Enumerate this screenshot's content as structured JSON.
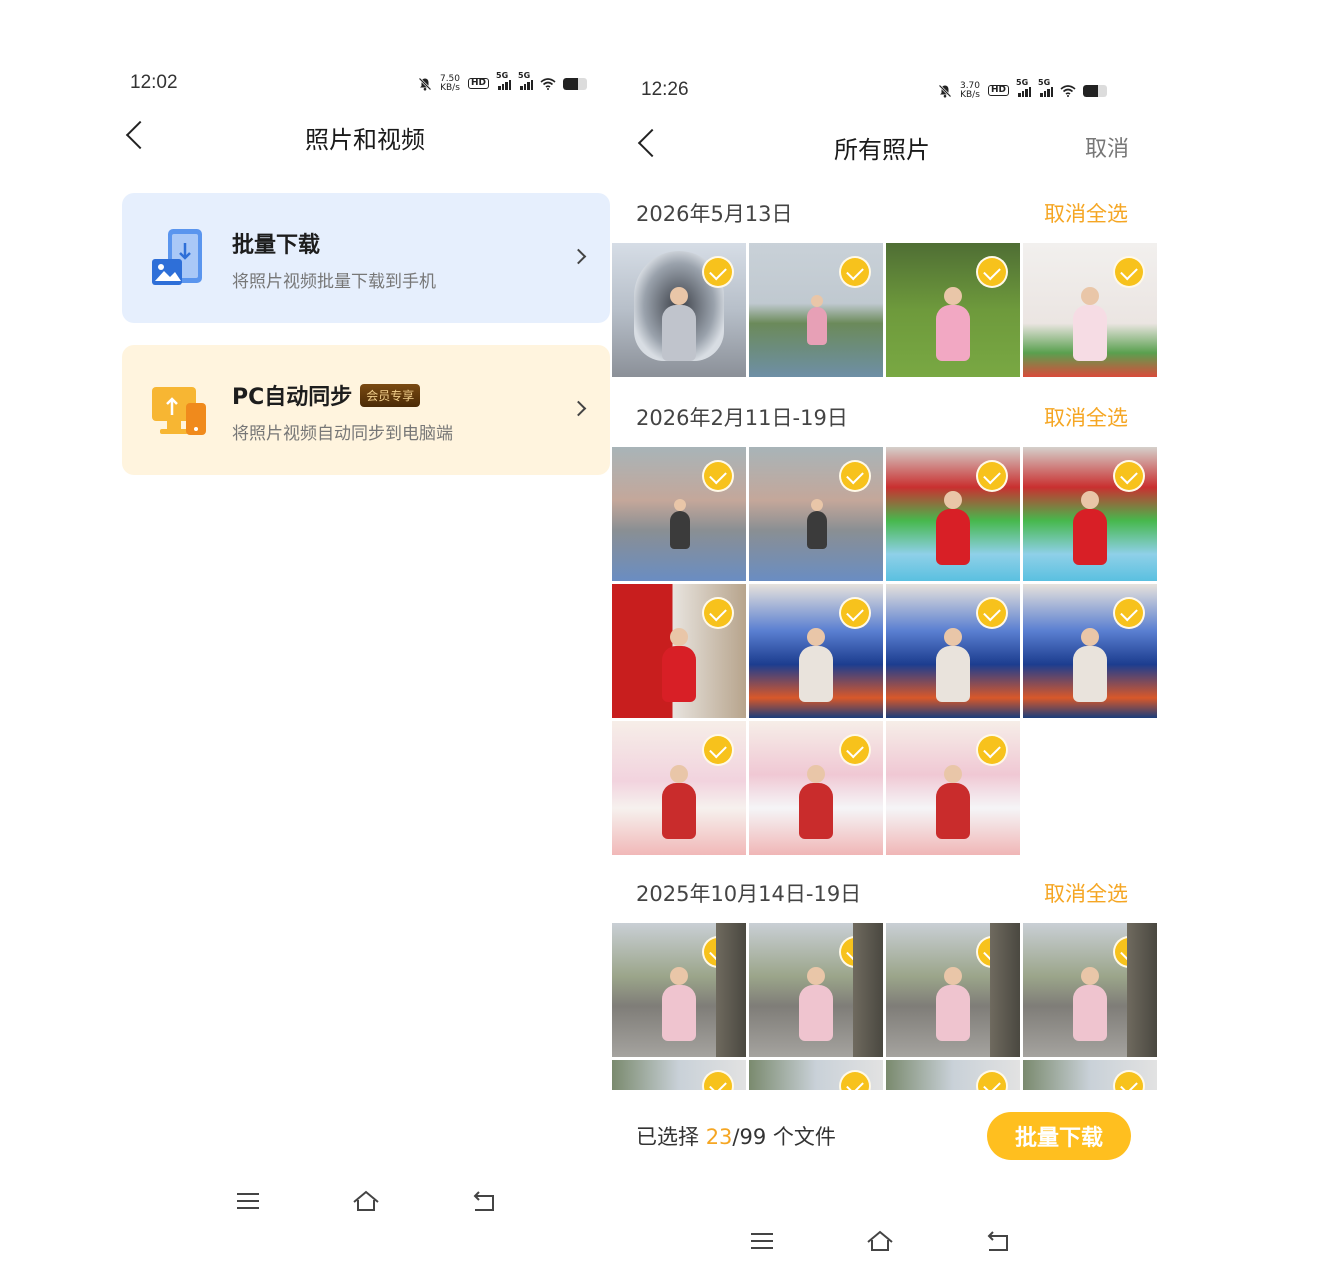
{
  "left_screen": {
    "status_bar": {
      "time": "12:02",
      "net_speed": "7.50",
      "net_unit": "KB/s"
    },
    "header": {
      "title": "照片和视频"
    },
    "cards": [
      {
        "title": "批量下载",
        "subtitle": "将照片视频批量下载到手机",
        "color": "#e6effd",
        "icon": "phone-download-icon"
      },
      {
        "title": "PC自动同步",
        "badge": "会员专享",
        "subtitle": "将照片视频自动同步到电脑端",
        "color": "#fff4de",
        "icon": "pc-sync-icon"
      }
    ]
  },
  "right_screen": {
    "status_bar": {
      "time": "12:26",
      "net_speed": "3.70",
      "net_unit": "KB/s"
    },
    "header": {
      "title": "所有照片",
      "cancel_label": "取消"
    },
    "sections": [
      {
        "date": "2026年5月13日",
        "action": "取消全选",
        "photos": [
          "airport",
          "lake",
          "grass",
          "bed"
        ]
      },
      {
        "date": "2026年2月11日-19日",
        "action": "取消全选",
        "photos": [
          "statue",
          "statue",
          "pool",
          "pool",
          "red",
          "koi",
          "koi",
          "koi",
          "play",
          "cow",
          "cow"
        ]
      },
      {
        "date": "2025年10月14日-19日",
        "action": "取消全选",
        "photos": [
          "street",
          "street",
          "street",
          "street",
          "strip",
          "strip",
          "strip",
          "strip"
        ]
      }
    ],
    "footer": {
      "selected_prefix": "已选择 ",
      "selected_count": "23",
      "selected_suffix": "/99 个文件",
      "download_label": "批量下载"
    },
    "accent_color": "#f5a623"
  },
  "nav_icons": [
    "menu-icon",
    "home-icon",
    "back-nav-icon"
  ]
}
